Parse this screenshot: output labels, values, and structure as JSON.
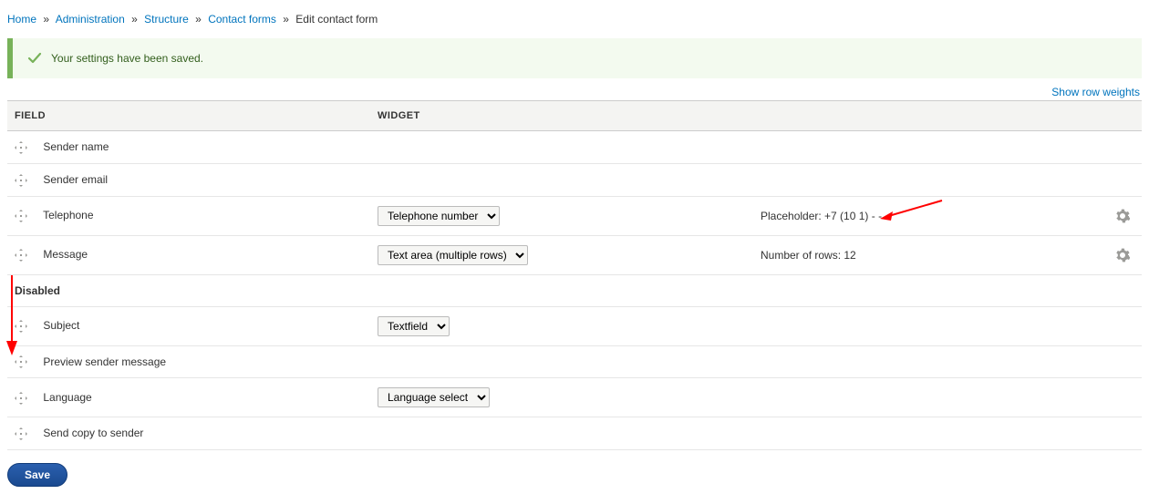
{
  "breadcrumb": [
    {
      "label": "Home",
      "is_link": true
    },
    {
      "label": "Administration",
      "is_link": true
    },
    {
      "label": "Structure",
      "is_link": true
    },
    {
      "label": "Contact forms",
      "is_link": true
    },
    {
      "label": "Edit contact form",
      "is_link": false
    }
  ],
  "message": {
    "text": "Your settings have been saved."
  },
  "toolbar": {
    "show_weights": "Show row weights"
  },
  "table": {
    "headers": {
      "field": "Field",
      "widget": "Widget"
    },
    "enabled_rows": [
      {
        "field": "Sender name",
        "widget": "",
        "summary": "",
        "has_settings": false
      },
      {
        "field": "Sender email",
        "widget": "",
        "summary": "",
        "has_settings": false
      },
      {
        "field": "Telephone",
        "widget": "Telephone number",
        "summary": "Placeholder: +7 (10 1) - - -",
        "has_settings": true
      },
      {
        "field": "Message",
        "widget": "Text area (multiple rows)",
        "summary": "Number of rows: 12",
        "has_settings": true
      }
    ],
    "disabled_label": "Disabled",
    "disabled_rows": [
      {
        "field": "Subject",
        "widget": "Textfield",
        "summary": "",
        "has_settings": false
      },
      {
        "field": "Preview sender message",
        "widget": "",
        "summary": "",
        "has_settings": false
      },
      {
        "field": "Language",
        "widget": "Language select",
        "summary": "",
        "has_settings": false
      },
      {
        "field": "Send copy to sender",
        "widget": "",
        "summary": "",
        "has_settings": false
      }
    ]
  },
  "buttons": {
    "save": "Save"
  }
}
